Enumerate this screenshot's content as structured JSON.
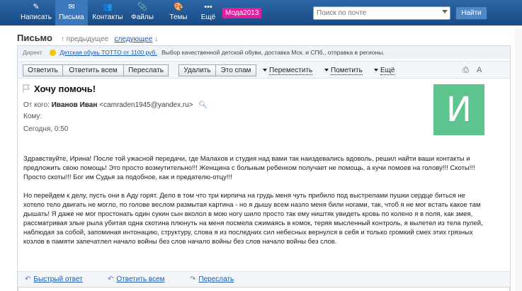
{
  "nav": {
    "items": [
      {
        "label": "Написать",
        "icon": "pencil-icon",
        "glyph": "✎"
      },
      {
        "label": "Письма",
        "icon": "envelope-icon",
        "glyph": "✉"
      },
      {
        "label": "Контакты",
        "icon": "contacts-icon",
        "glyph": "👥"
      },
      {
        "label": "Файлы",
        "icon": "files-icon",
        "glyph": "📎"
      },
      {
        "label": "Темы",
        "icon": "themes-icon",
        "glyph": "🎨"
      },
      {
        "label": "Ещё",
        "icon": "more-icon",
        "glyph": "•••"
      }
    ],
    "promo": "Мода2013",
    "search_placeholder": "Поиск по почте",
    "search_button": "Найти"
  },
  "header": {
    "title": "Письмо",
    "prev": "↑ предыдущее",
    "next": "следующее",
    "next_arrow": "↓"
  },
  "ad": {
    "tag": "Директ",
    "link": "Детская обувь TOTTO от 1100 руб.",
    "text": "Выбор качественной детской обуви, доставка Мск. и СПб., отправка в регионы."
  },
  "toolbar": {
    "reply": "Ответить",
    "reply_all": "Ответить всем",
    "forward": "Переслать",
    "delete": "Удалить",
    "spam": "Это спам",
    "move": "Переместить",
    "mark": "Пометить",
    "more": "Ещё"
  },
  "message": {
    "subject": "Хочу помочь!",
    "from_label": "От кого:",
    "sender_name": "Иванов Иван",
    "sender_email": "<camraden1945@yandex.ru>",
    "to_label": "Кому:",
    "date": "Сегодня, 0:50",
    "avatar_letter": "И",
    "avatar_color": "#5ec48e",
    "paragraphs": [
      "Здравствуйте, Ирина! После той ужасной передачи, где Малахов и студия над вами так наиздевались вдоволь, решил найти ваши контакты и предложить свою помощь! Это просто возмутительно!!! Женщина с больным ребенком получает не помощь, а кучи помоев на голову!!! Скоты!!! Просто скоты!!! Бог им Судья за подобное, как и предателю-отцу!!!",
      "Но перейдем к делу, пусть они в Аду горят. Дело в том что три кирпича на грудь меня чуть прибило под выстрелами пушки сердце биться не хотело тело двигать не могло, по голове веслом размытая картина - но я дышу всем назло меня били ногами, так, чтоб я не мог встать какое там дышать! Я даже не мог простонать один сукин сын вколол в мою ногу шило просто так ему ништяк увидеть кровь по колено я в поля, как змея, рассматривая злые рыла убитая одна скотина плюнуть на меня посмела сжимаясь в комок, теряя мысленный контроль, я вылетел из тела пулей, наблюдая за собой, запоминая интонацию, структуру, слова я из последних сил небесных вернулся в себя и только громкий смех этих грязных козлов в памяти запечатлел начало войны без слов начало войны без слов начало войны без слов."
    ]
  },
  "bottom": {
    "quick_reply": "Быстрый ответ",
    "reply_all": "Ответить всем",
    "forward": "Переслать"
  },
  "colors": {
    "topbar": "#1a4f8b",
    "link": "#1a5bb5",
    "promo": "#e41ca0"
  }
}
